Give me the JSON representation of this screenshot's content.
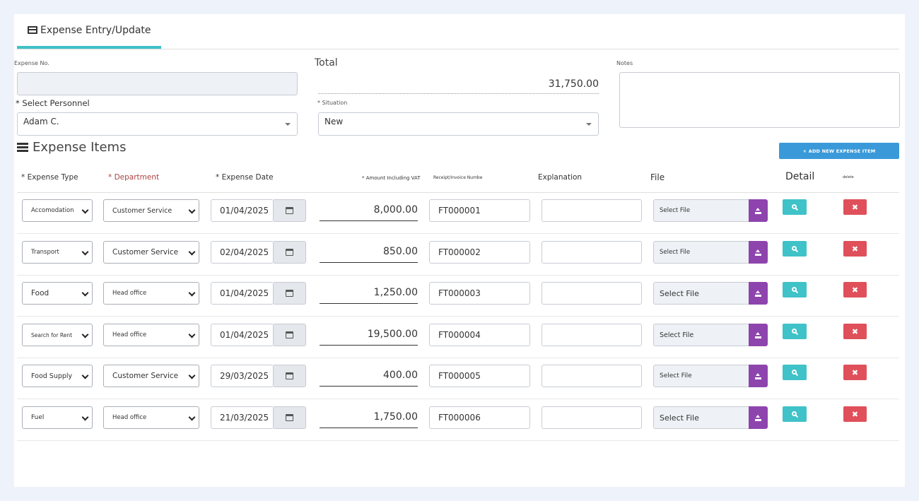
{
  "tab": {
    "label": "Expense Entry/Update",
    "icon": "credit-card-icon"
  },
  "form": {
    "expense_no_label": "Expense No.",
    "expense_no_value": "",
    "total_label": "Total",
    "total_value": "31,750.00",
    "notes_label": "Notes",
    "notes_value": "",
    "personnel_label": "* Select Personnel",
    "personnel_value": "Adam C.",
    "situation_label": "* Situation",
    "situation_value": "New"
  },
  "items": {
    "title": "Expense Items",
    "icon": "list-icon",
    "add_button": "+ ADD NEW EXPENSE ITEM",
    "headers": {
      "expense_type": "* Expense Type",
      "department": "* Department",
      "expense_date": "* Expense Date",
      "amount": "* Amount Including VAT",
      "receipt": "Receipt/Invoice Numbe",
      "explanation": "Explanation",
      "file": "File",
      "detail": "Detail",
      "delete": "delete"
    },
    "file_placeholder": "Select File",
    "delete_symbol": "✖",
    "rows": [
      {
        "type": "Accomodation",
        "department": "Customer Service",
        "date": "01/04/2025",
        "amount": "8,000.00",
        "receipt": "FT000001",
        "explanation": "",
        "file": "Select File"
      },
      {
        "type": "Transport",
        "department": "Customer Service",
        "date": "02/04/2025",
        "amount": "850.00",
        "receipt": "FT000002",
        "explanation": "",
        "file": "Select File"
      },
      {
        "type": "Food",
        "department": "Head office",
        "date": "01/04/2025",
        "amount": "1,250.00",
        "receipt": "FT000003",
        "explanation": "",
        "file": "Select File"
      },
      {
        "type": "Search for Rent",
        "department": "Head office",
        "date": "01/04/2025",
        "amount": "19,500.00",
        "receipt": "FT000004",
        "explanation": "",
        "file": "Select File"
      },
      {
        "type": "Food Supply",
        "department": "Customer Service",
        "date": "29/03/2025",
        "amount": "400.00",
        "receipt": "FT000005",
        "explanation": "",
        "file": "Select File"
      },
      {
        "type": "Fuel",
        "department": "Head office",
        "date": "21/03/2025",
        "amount": "1,750.00",
        "receipt": "FT000006",
        "explanation": "",
        "file": "Select File"
      }
    ]
  }
}
